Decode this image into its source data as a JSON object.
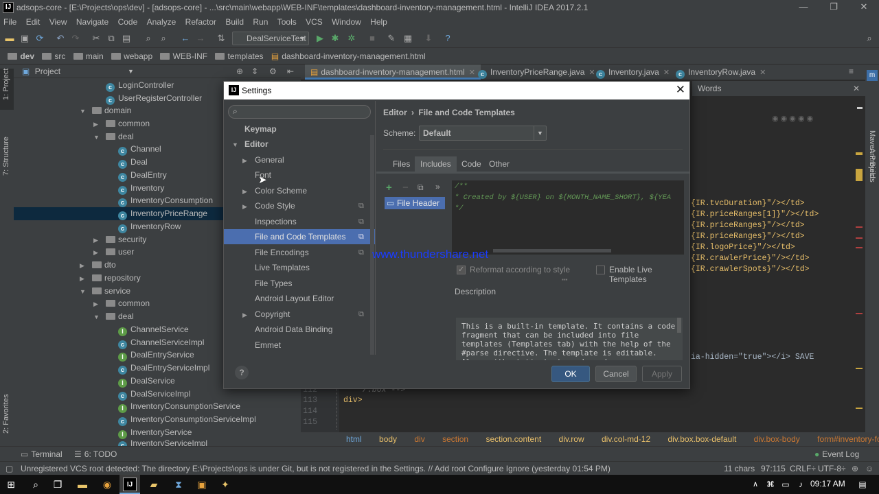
{
  "window": {
    "title": "adsops-core - [E:\\Projects\\ops\\dev] - [adsops-core] - ...\\src\\main\\webapp\\WEB-INF\\templates\\dashboard-inventory-management.html - IntelliJ IDEA 2017.2.1",
    "app_icon": "IJ"
  },
  "menu": [
    "File",
    "Edit",
    "View",
    "Navigate",
    "Code",
    "Analyze",
    "Refactor",
    "Build",
    "Run",
    "Tools",
    "VCS",
    "Window",
    "Help"
  ],
  "toolbar": {
    "run_config": "DealServiceTest"
  },
  "navbar": [
    "dev",
    "src",
    "main",
    "webapp",
    "WEB-INF",
    "templates",
    "dashboard-inventory-management.html"
  ],
  "left_stripe": {
    "project": "1: Project",
    "structure": "7: Structure",
    "favorites": "2: Favorites"
  },
  "project_panel": {
    "header": "Project",
    "items": [
      {
        "label": "LoginController",
        "kind": "class"
      },
      {
        "label": "UserRegisterController",
        "kind": "class"
      },
      {
        "label": "domain",
        "kind": "folder",
        "state": "open"
      },
      {
        "label": "common",
        "kind": "folder",
        "state": "closed"
      },
      {
        "label": "deal",
        "kind": "folder",
        "state": "open"
      },
      {
        "label": "Channel",
        "kind": "class"
      },
      {
        "label": "Deal",
        "kind": "class"
      },
      {
        "label": "DealEntry",
        "kind": "class"
      },
      {
        "label": "Inventory",
        "kind": "class"
      },
      {
        "label": "InventoryConsumption",
        "kind": "class"
      },
      {
        "label": "InventoryPriceRange",
        "kind": "class",
        "selected": true
      },
      {
        "label": "InventoryRow",
        "kind": "class"
      },
      {
        "label": "security",
        "kind": "folder",
        "state": "closed"
      },
      {
        "label": "user",
        "kind": "folder",
        "state": "closed"
      },
      {
        "label": "dto",
        "kind": "folder",
        "state": "closed"
      },
      {
        "label": "repository",
        "kind": "folder",
        "state": "closed"
      },
      {
        "label": "service",
        "kind": "folder",
        "state": "open"
      },
      {
        "label": "common",
        "kind": "folder",
        "state": "closed"
      },
      {
        "label": "deal",
        "kind": "folder",
        "state": "open"
      },
      {
        "label": "ChannelService",
        "kind": "interface"
      },
      {
        "label": "ChannelServiceImpl",
        "kind": "class"
      },
      {
        "label": "DealEntryService",
        "kind": "interface"
      },
      {
        "label": "DealEntryServiceImpl",
        "kind": "class"
      },
      {
        "label": "DealService",
        "kind": "interface"
      },
      {
        "label": "DealServiceImpl",
        "kind": "class"
      },
      {
        "label": "InventoryConsumptionService",
        "kind": "interface"
      },
      {
        "label": "InventoryConsumptionServiceImpl",
        "kind": "class"
      },
      {
        "label": "InventoryService",
        "kind": "interface"
      },
      {
        "label": "InventoryServiceImpl",
        "kind": "class"
      }
    ]
  },
  "editor_tabs": [
    {
      "label": "dashboard-inventory-management.html",
      "active": true
    },
    {
      "label": "InventoryPriceRange.java"
    },
    {
      "label": "Inventory.java"
    },
    {
      "label": "InventoryRow.java"
    }
  ],
  "words_panel": "Words",
  "code_lines": [
    "{IR.tvcDuration}\"/></td>",
    "{IR.priceRanges[1]}\"/></td>",
    "{IR.priceRanges}\"/></td>",
    "{IR.priceRanges}\"/></td>",
    "{IR.logoPrice}\"/></td>",
    "{IR.crawlerPrice}\"/></td>",
    "{IR.crawlerSpots}\"/></td>"
  ],
  "code_save_line": "ia-hidden=\"true\"></i> SAVE",
  "gutter": [
    {
      "num": "113",
      "code": "div>"
    },
    {
      "num": "114",
      "code": ""
    },
    {
      "num": "115",
      "code": ""
    }
  ],
  "gutter_partial": "/.box -->",
  "breadcrumbs": [
    "html",
    "body",
    "div",
    "section",
    "section.content",
    "div.row",
    "div.col-md-12",
    "div.box.box-default",
    "div.box-body",
    "form#inventory-form"
  ],
  "tool_windows": {
    "terminal": "Terminal",
    "todo": "6: TODO",
    "event_log": "Event Log"
  },
  "status": {
    "message": "Unregistered VCS root detected: The directory E:\\Projects\\ops is under Git, but is not registered in the Settings. // Add root  Configure  Ignore (yesterday 01:54 PM)",
    "chars": "11 chars",
    "position": "97:115",
    "line_sep": "CRLF÷",
    "encoding": "UTF-8÷"
  },
  "taskbar": {
    "time": "09:17 AM"
  },
  "settings": {
    "title": "Settings",
    "search_placeholder": "",
    "nav": [
      {
        "label": "Keymap",
        "level": 0,
        "bold": true
      },
      {
        "label": "Editor",
        "level": 0,
        "bold": true,
        "expanded": true
      },
      {
        "label": "General",
        "level": 1,
        "arrow": true
      },
      {
        "label": "Font",
        "level": 1
      },
      {
        "label": "Color Scheme",
        "level": 1,
        "arrow": true
      },
      {
        "label": "Code Style",
        "level": 1,
        "arrow": true,
        "copy": true
      },
      {
        "label": "Inspections",
        "level": 1,
        "copy": true
      },
      {
        "label": "File and Code Templates",
        "level": 1,
        "copy": true,
        "selected": true
      },
      {
        "label": "File Encodings",
        "level": 1,
        "copy": true
      },
      {
        "label": "Live Templates",
        "level": 1
      },
      {
        "label": "File Types",
        "level": 1
      },
      {
        "label": "Android Layout Editor",
        "level": 1
      },
      {
        "label": "Copyright",
        "level": 1,
        "arrow": true,
        "copy": true
      },
      {
        "label": "Android Data Binding",
        "level": 1
      },
      {
        "label": "Emmet",
        "level": 1
      }
    ],
    "breadcrumb_parent": "Editor",
    "breadcrumb_current": "File and Code Templates",
    "scheme_label": "Scheme:",
    "scheme_value": "Default",
    "tabs": [
      {
        "label": "Files"
      },
      {
        "label": "Includes",
        "active": true
      },
      {
        "label": "Code"
      },
      {
        "label": "Other"
      }
    ],
    "template_item": "File Header",
    "template_code": [
      "/**",
      " * Created by ${USER} on ${MONTH_NAME_SHORT}, ${YEA",
      " */"
    ],
    "reformat_label": "Reformat according to style",
    "live_templates_label": "Enable Live Templates",
    "description_label": "Description",
    "description_html": "This is a built-in template. It contains a code fragment that can be included into file templates (Templates tab) with the help of the #parse directive. The template is editable. Along with static text, code and",
    "watermark": "www.thundershare.net",
    "buttons": {
      "ok": "OK",
      "cancel": "Cancel",
      "apply": "Apply"
    }
  },
  "colors": {
    "accent": "#4b6eaf",
    "ide_bg": "#2b2b2b",
    "panel_bg": "#3c3f41",
    "selection": "#0d293e",
    "watermark": "#1a3cff"
  }
}
